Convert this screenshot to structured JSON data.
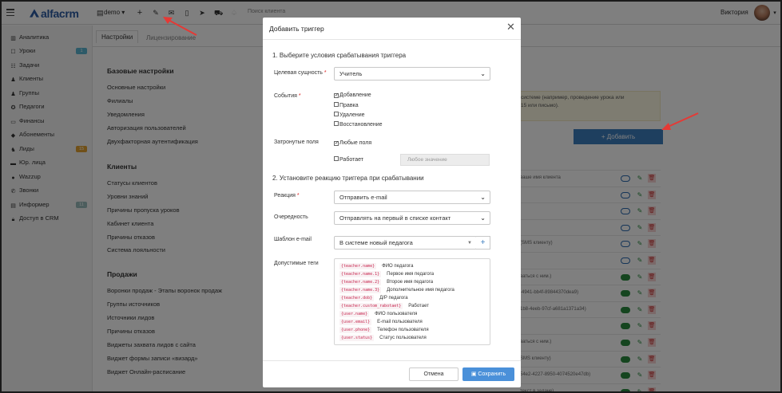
{
  "app": {
    "logo_text": "alfacrm"
  },
  "topbar": {
    "branch": "demo",
    "search_placeholder": "Поиск клиента",
    "user_name": "Виктория"
  },
  "sidebar": {
    "items": [
      {
        "label": "Аналитика",
        "icon": "chart-icon"
      },
      {
        "label": "Уроки",
        "icon": "calendar-icon",
        "badge": "1"
      },
      {
        "label": "Задачи",
        "icon": "tasks-icon"
      },
      {
        "label": "Клиенты",
        "icon": "user-icon"
      },
      {
        "label": "Группы",
        "icon": "users-icon"
      },
      {
        "label": "Педагоги",
        "icon": "teacher-icon"
      },
      {
        "label": "Финансы",
        "icon": "money-icon"
      },
      {
        "label": "Абонементы",
        "icon": "tag-icon"
      },
      {
        "label": "Лиды",
        "icon": "leads-icon",
        "badge": "15"
      },
      {
        "label": "Юр. лица",
        "icon": "briefcase-icon"
      },
      {
        "label": "Wazzup",
        "icon": "whatsapp-icon"
      },
      {
        "label": "Звонки",
        "icon": "phone-icon"
      },
      {
        "label": "Информер",
        "icon": "informer-icon",
        "badge": "11"
      },
      {
        "label": "Доступ в CRM",
        "icon": "lock-icon"
      }
    ]
  },
  "main": {
    "tabs": [
      {
        "label": "Настройки"
      },
      {
        "label": "Лицензирование"
      }
    ],
    "sections": [
      {
        "title": "Базовые настройки",
        "links": [
          "Основные настройки",
          "Филиалы",
          "Уведомления",
          "Авторизация пользователей",
          "Двухфакторная аутентификация"
        ]
      },
      {
        "title": "Клиенты",
        "links": [
          "Статусы клиентов",
          "Уровни знаний",
          "Причины пропуска уроков",
          "Кабинет клиента",
          "Причины отказов",
          "Система лояльности"
        ]
      },
      {
        "title": "Продажи",
        "links": [
          "Воронки продаж - Этапы воронок продаж",
          "Группы источников",
          "Источники лидов",
          "Причины отказов",
          "Виджеты захвата лидов с сайта",
          "Виджет формы записи «визард»",
          "Виджет Онлайн-расписание"
        ]
      }
    ],
    "info_text_line1": "системе (например, проведение урока или",
    "info_text_line2": "15 или письмо).",
    "add_button": "+ Добавить",
    "trigger_rows": [
      {
        "text": "ваше имя клиента",
        "on": false
      },
      {
        "text": "",
        "on": false
      },
      {
        "text": "",
        "on": false
      },
      {
        "text": "",
        "on": false
      },
      {
        "text": "(SMS клиенту)",
        "on": false
      },
      {
        "text": "",
        "on": false
      },
      {
        "text": "ваться с ним.)",
        "on": true
      },
      {
        "text": "-4941-bb4f-89844370dea9)",
        "on": true
      },
      {
        "text": "1b8-4eeb-97cf-a681a1371a34)",
        "on": true
      },
      {
        "text": "",
        "on": true
      },
      {
        "text": "ваться с ним.)",
        "on": true
      },
      {
        "text": "SMS клиенту)",
        "on": true
      },
      {
        "text": "54e2-4227-8950-4074520e47db)",
        "on": true
      },
      {
        "text": "текст в задаче)",
        "on": true
      }
    ]
  },
  "modal": {
    "title": "Добавить триггер",
    "step1": "1. Выберите условия срабатывания триггера",
    "target_label": "Целевая сущность",
    "target_value": "Учитель",
    "events_label": "События",
    "events": [
      {
        "label": "Добавление",
        "checked": true
      },
      {
        "label": "Правка",
        "checked": false
      },
      {
        "label": "Удаление",
        "checked": false
      },
      {
        "label": "Восстановление",
        "checked": false
      }
    ],
    "fields_label": "Затронутые поля",
    "any_fields": {
      "label": "Любые поля",
      "checked": true
    },
    "works": {
      "label": "Работает",
      "checked": false
    },
    "any_value_placeholder": "Любое значение",
    "step2": "2. Установите реакцию триггера при срабатывании",
    "reaction_label": "Реакция",
    "reaction_value": "Отправить e-mail",
    "order_label": "Очередность",
    "order_value": "Отправлять на первый в списке контакт",
    "template_label": "Шаблон e-mail",
    "template_value": "В системе новый педагога",
    "tags_label": "Допустимые теги",
    "tags": [
      {
        "code": "{teacher.name}",
        "desc": "ФИО педагога"
      },
      {
        "code": "{teacher.name.1}",
        "desc": "Первое имя педагога"
      },
      {
        "code": "{teacher.name.2}",
        "desc": "Второе имя педагога"
      },
      {
        "code": "{teacher.name.3}",
        "desc": "Дополнительное имя педагога"
      },
      {
        "code": "{teacher.dob}",
        "desc": "Д/Р педагога"
      },
      {
        "code": "{teacher.custom_rabotaet}",
        "desc": "Работает"
      },
      {
        "code": "{user.name}",
        "desc": "ФИО пользователя"
      },
      {
        "code": "{user.email}",
        "desc": "E-mail пользователя"
      },
      {
        "code": "{user.phone}",
        "desc": "Телефон пользователя"
      },
      {
        "code": "{user.status}",
        "desc": "Статус пользователя"
      }
    ],
    "cancel": "Отмена",
    "save": "Сохранить"
  },
  "colors": {
    "brand": "#2b5aa3",
    "primary": "#3d7ebf",
    "save": "#4a90d9",
    "accent_arrow": "#e53935"
  }
}
